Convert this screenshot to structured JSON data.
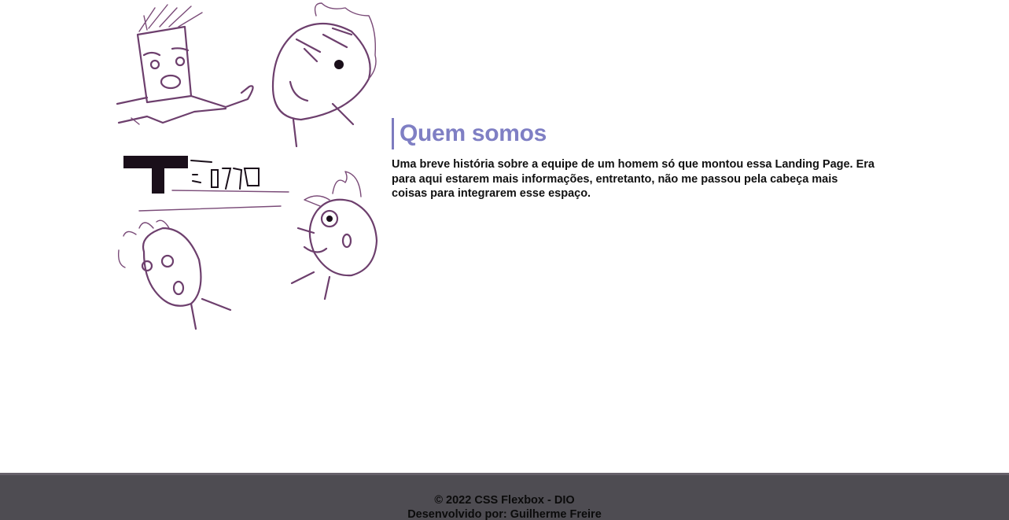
{
  "about": {
    "illustration_icon": "team-sketch-illustration",
    "title": "Quem somos",
    "description": "Uma breve história sobre a equipe de um homem só que montou essa Landing Page. Era para aqui estarem mais informações, entretanto, não me passou pela cabeça mais coisas para integrarem esse espaço."
  },
  "footer": {
    "copyright": "© 2022 CSS Flexbox - DIO",
    "credits": "Desenvolvido por: Guilherme Freire"
  },
  "colors": {
    "title_accent": "#7f7fc4",
    "footer_bg": "#4e4c52",
    "sketch_ink": "#6d3f6d"
  }
}
